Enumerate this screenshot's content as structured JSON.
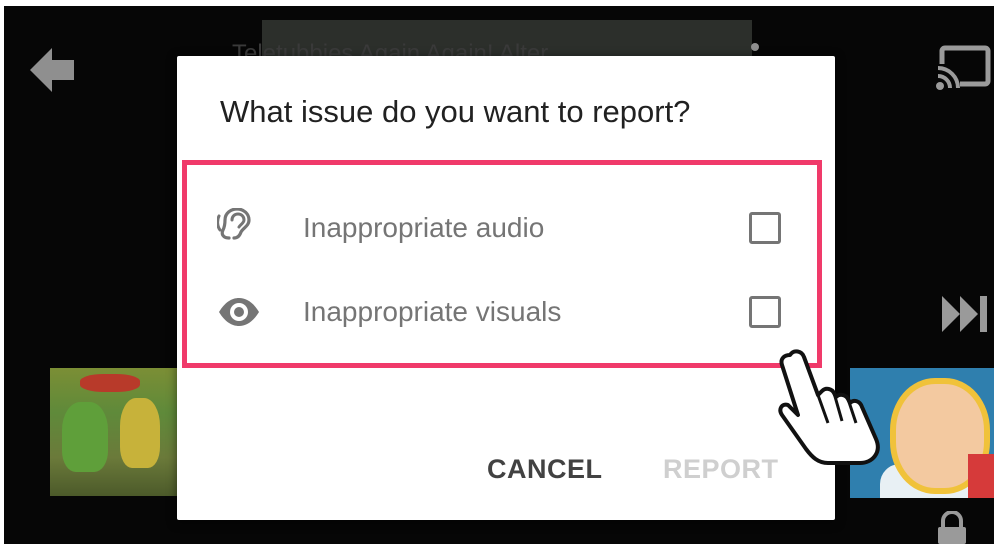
{
  "background": {
    "video_title": "Teletubbies Again Again! Alter"
  },
  "dialog": {
    "title": "What issue do you want to report?",
    "options": [
      {
        "label": "Inappropriate audio",
        "icon": "ear-icon",
        "checked": false
      },
      {
        "label": "Inappropriate visuals",
        "icon": "eye-icon",
        "checked": false
      }
    ],
    "cancel_label": "CANCEL",
    "report_label": "REPORT"
  },
  "colors": {
    "highlight_border": "#f03a6a",
    "report_disabled": "#cfcfcf",
    "cancel_text": "#424242"
  },
  "icons": [
    "back-arrow-icon",
    "cast-icon",
    "more-vert-icon",
    "skip-next-icon",
    "lock-icon",
    "hand-pointer-icon"
  ]
}
